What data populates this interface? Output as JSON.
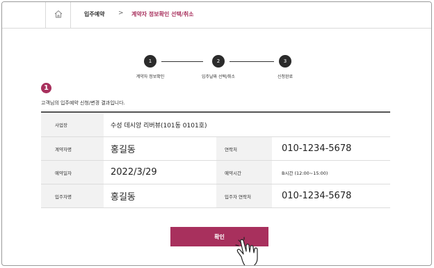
{
  "breadcrumb": {
    "home_icon": "home-icon",
    "level1": "입주예약",
    "separator": ">",
    "level2": "계약자 정보확인 선택/취소",
    "accent": "#a8305d"
  },
  "steps": [
    {
      "number": "1",
      "label": "계약자 정보확인"
    },
    {
      "number": "2",
      "label": "입주날짜 선택/취소"
    },
    {
      "number": "3",
      "label": "신청완료"
    }
  ],
  "badge": "1",
  "intro": "고객님의 입주예약 신청/변경 결과입니다.",
  "table": {
    "site_label": "사업장",
    "site_value": "수성 데시앙 리버뷰(101동 0101호)",
    "contractor_label": "계약자명",
    "contractor_value": "홍길동",
    "contact_label": "연락처",
    "contact_value": "010-1234-5678",
    "date_label": "예약일자",
    "date_value": "2022/3/29",
    "time_label": "예약시간",
    "time_value": "B시간 (12:00~15:00)",
    "resident_label": "입주자명",
    "resident_value": "홍길동",
    "resident_contact_label": "입주자 연락처",
    "resident_contact_value": "010-1234-5678"
  },
  "confirm_button": "확인",
  "cursor_icon": "hand-pointer-icon"
}
